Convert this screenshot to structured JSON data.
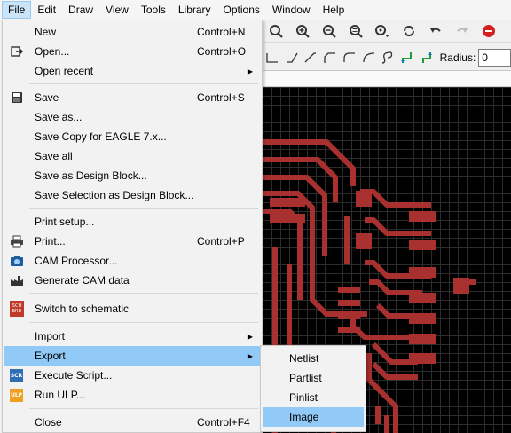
{
  "menubar": {
    "items": [
      "File",
      "Edit",
      "Draw",
      "View",
      "Tools",
      "Library",
      "Options",
      "Window",
      "Help"
    ]
  },
  "file_menu": {
    "new": {
      "label": "New",
      "shortcut": "Control+N"
    },
    "open": {
      "label": "Open...",
      "shortcut": "Control+O"
    },
    "open_recent": {
      "label": "Open recent"
    },
    "save": {
      "label": "Save",
      "shortcut": "Control+S"
    },
    "save_as": {
      "label": "Save as..."
    },
    "save_copy": {
      "label": "Save Copy for EAGLE 7.x..."
    },
    "save_all": {
      "label": "Save all"
    },
    "save_design_block": {
      "label": "Save as Design Block..."
    },
    "save_selection_block": {
      "label": "Save Selection as Design Block..."
    },
    "print_setup": {
      "label": "Print setup..."
    },
    "print": {
      "label": "Print...",
      "shortcut": "Control+P"
    },
    "cam_processor": {
      "label": "CAM Processor..."
    },
    "generate_cam": {
      "label": "Generate CAM data"
    },
    "switch_schematic": {
      "label": "Switch to schematic"
    },
    "import": {
      "label": "Import"
    },
    "export": {
      "label": "Export"
    },
    "execute_script": {
      "label": "Execute Script..."
    },
    "run_ulp": {
      "label": "Run ULP..."
    },
    "close": {
      "label": "Close",
      "shortcut": "Control+F4"
    }
  },
  "export_submenu": {
    "items": [
      "Netlist",
      "Partlist",
      "Pinlist",
      "Image"
    ]
  },
  "toolbar": {
    "radius_label": "Radius:",
    "radius_value": "0"
  },
  "icons": {
    "scr_badge": "SCR",
    "ulp_badge": "ULP",
    "sch_badge": "SCH BRD"
  },
  "colors": {
    "trace": "#a8302e",
    "menu_hover": "#91c9f7",
    "board_bg": "#000000"
  }
}
